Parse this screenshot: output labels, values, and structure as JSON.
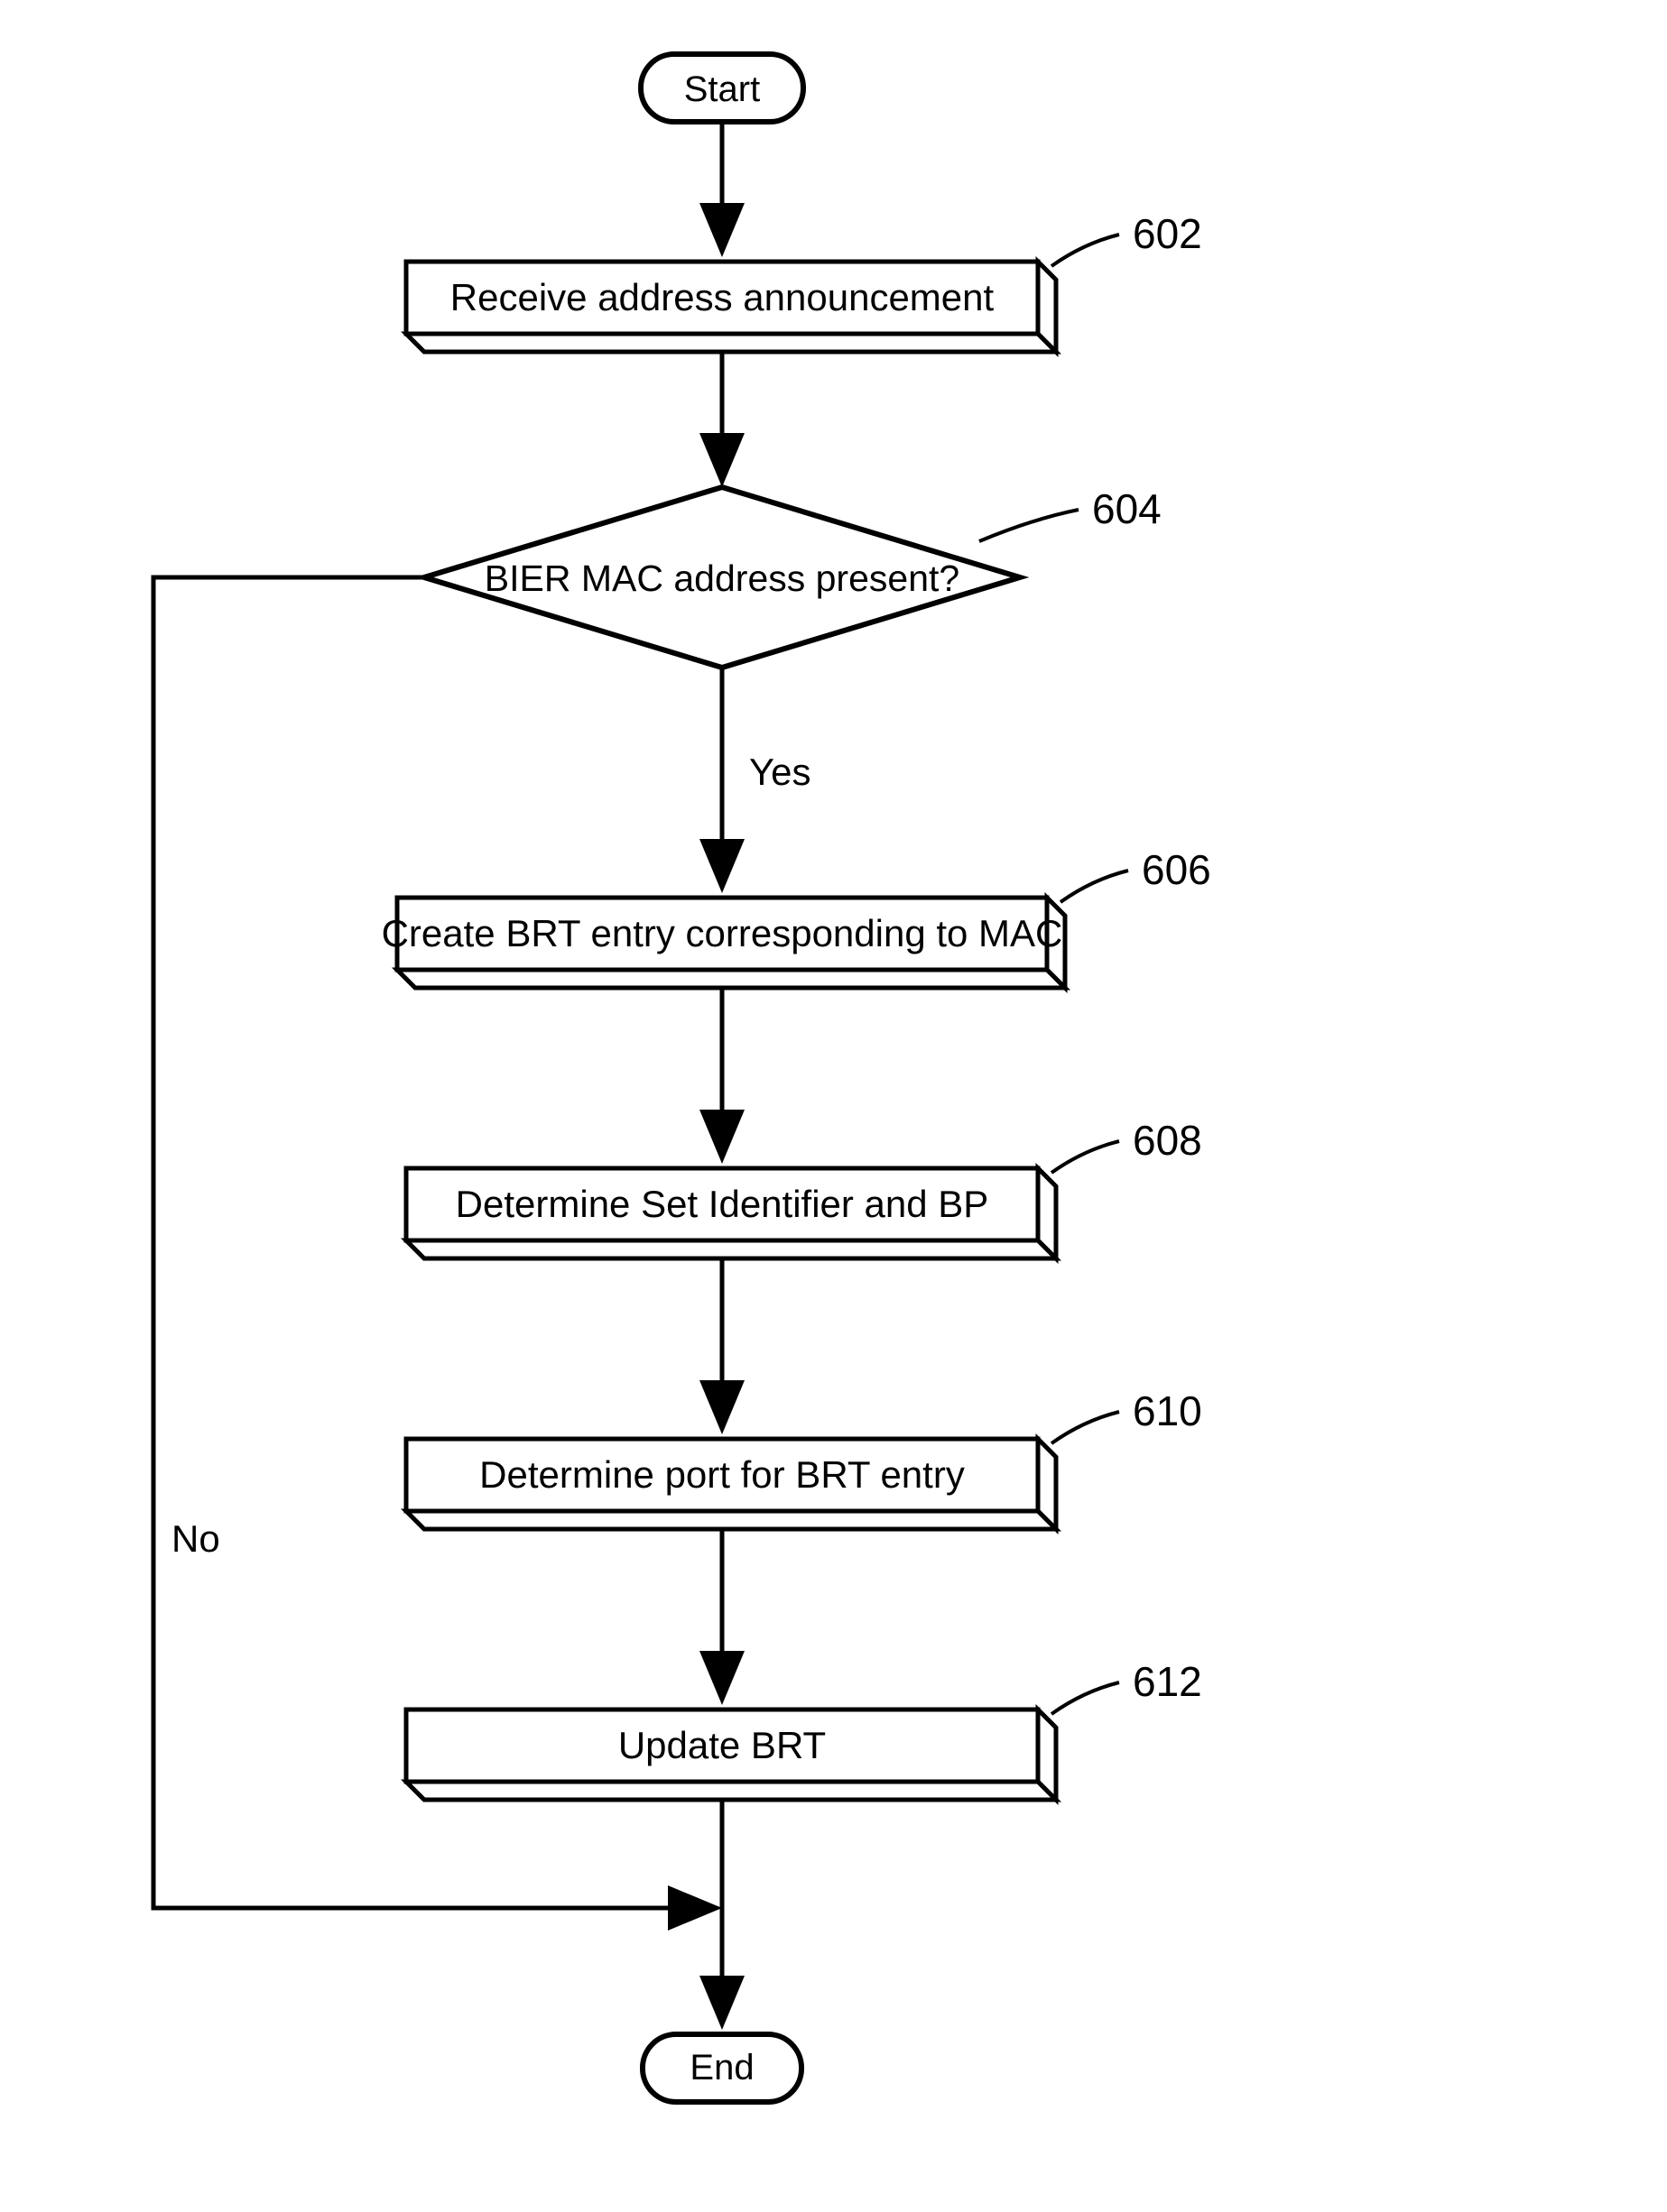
{
  "terminals": {
    "start": "Start",
    "end": "End"
  },
  "steps": {
    "receive": "Receive address announcement",
    "decision": "BIER MAC address present?",
    "create": "Create BRT entry corresponding to MAC",
    "determine_set": "Determine Set Identifier and BP",
    "determine_port": "Determine port for BRT entry",
    "update": "Update BRT"
  },
  "labels": {
    "yes": "Yes",
    "no": "No"
  },
  "refs": {
    "r602": "602",
    "r604": "604",
    "r606": "606",
    "r608": "608",
    "r610": "610",
    "r612": "612"
  }
}
